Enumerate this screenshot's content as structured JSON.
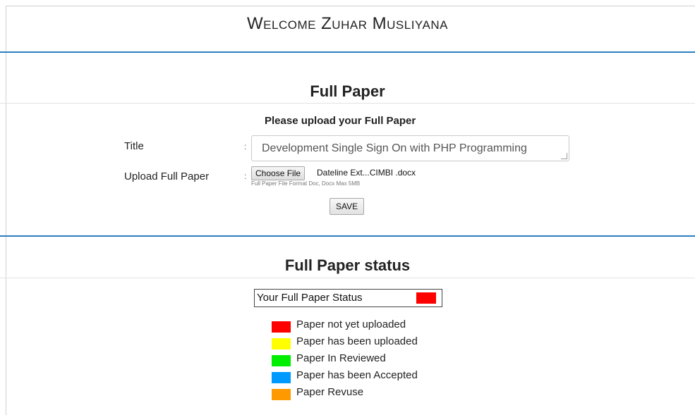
{
  "header": {
    "welcome": "Welcome Zuhar Musliyana"
  },
  "full_paper": {
    "heading": "Full Paper",
    "instruction": "Please upload your Full Paper",
    "title_label": "Title",
    "title_value": "Development Single Sign On with PHP Programming",
    "upload_label": "Upload Full Paper",
    "colon": ":",
    "choose_file_label": "Choose File",
    "file_name": "Dateline Ext...CIMBI .docx",
    "file_hint": "Full Paper File Format Doc, Docx Max 5MB",
    "save_label": "SAVE"
  },
  "status": {
    "heading": "Full Paper status",
    "box_label": "Your Full Paper Status",
    "current_color": "#ff0000",
    "legend": [
      {
        "label": "Paper not yet uploaded",
        "color": "#ff0000"
      },
      {
        "label": "Paper has been uploaded",
        "color": "#ffff00"
      },
      {
        "label": "Paper In Reviewed",
        "color": "#00ee00"
      },
      {
        "label": "Paper has been Accepted",
        "color": "#0099ff"
      },
      {
        "label": "Paper Revuse",
        "color": "#ff9900"
      }
    ]
  },
  "colors": {
    "accent_rule": "#2c7fbf"
  }
}
